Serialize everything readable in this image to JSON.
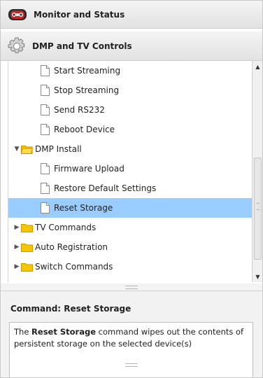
{
  "accordion": {
    "monitor_label": "Monitor and Status",
    "controls_label": "DMP and TV Controls"
  },
  "tree": {
    "items": [
      {
        "label": "Start Streaming"
      },
      {
        "label": "Stop Streaming"
      },
      {
        "label": "Send RS232"
      },
      {
        "label": "Reboot Device"
      },
      {
        "label": "DMP Install"
      },
      {
        "label": "Firmware Upload"
      },
      {
        "label": "Restore Default Settings"
      },
      {
        "label": "Reset Storage"
      },
      {
        "label": "TV Commands"
      },
      {
        "label": "Auto Registration"
      },
      {
        "label": "Switch Commands"
      }
    ]
  },
  "command_panel": {
    "title": "Command: Reset Storage",
    "desc_prefix": "The ",
    "desc_bold": "Reset Storage",
    "desc_suffix": " command wipes out the contents of persistent storage on the selected device(s)"
  },
  "colors": {
    "selected_row": "#99ccff",
    "folder": "#f5c600"
  }
}
